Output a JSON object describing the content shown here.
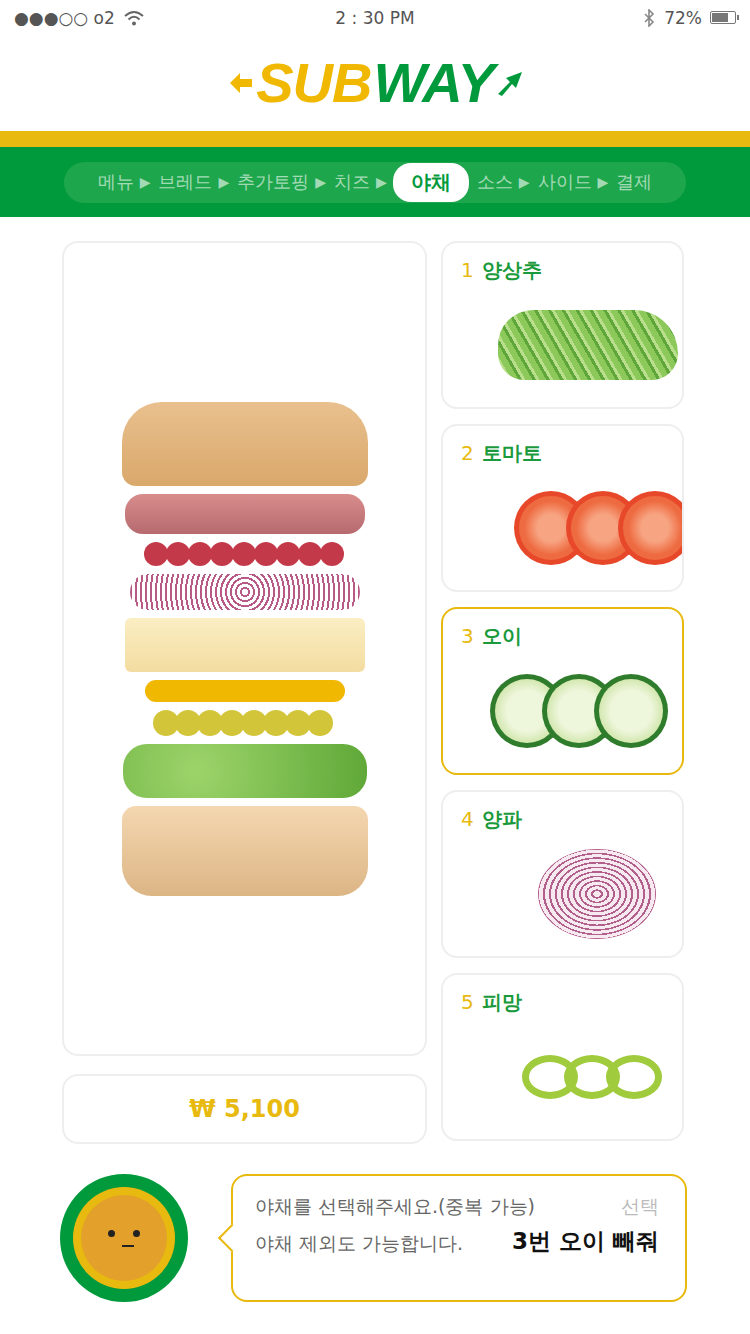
{
  "status_bar": {
    "carrier": "●●●○○ o2",
    "time": "2 : 30 PM",
    "battery": "72%",
    "battery_level": 0.72
  },
  "logo": [
    {
      "text": "SUB",
      "color": "#f0b800"
    },
    {
      "text": "WAY",
      "color": "#009a3d"
    }
  ],
  "steps": [
    {
      "label": "메뉴",
      "selected": false,
      "arrow": "▶"
    },
    {
      "label": "브레드",
      "selected": false,
      "arrow": "▶"
    },
    {
      "label": "추가토핑",
      "selected": false,
      "arrow": "▶"
    },
    {
      "label": "치즈",
      "selected": false,
      "arrow": "▶"
    },
    {
      "label": "야채",
      "selected": true
    },
    {
      "label": "소스",
      "selected": false,
      "arrow": "▶"
    },
    {
      "label": "사이드",
      "selected": false,
      "arrow": "▶"
    },
    {
      "label": "결제",
      "selected": false
    }
  ],
  "price": "₩ 5,100",
  "vegetables": [
    {
      "number": "1",
      "name": "양상추",
      "selected": false,
      "kind": "lettuce"
    },
    {
      "number": "2",
      "name": "토마토",
      "selected": false,
      "kind": "tomato"
    },
    {
      "number": "3",
      "name": "오이",
      "selected": true,
      "kind": "cucumber"
    },
    {
      "number": "4",
      "name": "양파",
      "selected": false,
      "kind": "onion"
    },
    {
      "number": "5",
      "name": "피망",
      "selected": false,
      "kind": "pepper"
    }
  ],
  "assistant": {
    "prompt_lines": [
      "야채를 선택해주세요.(중복 가능)",
      "야채 제외도 가능합니다."
    ],
    "action": "선택",
    "voice": "3번 오이 빼줘"
  }
}
